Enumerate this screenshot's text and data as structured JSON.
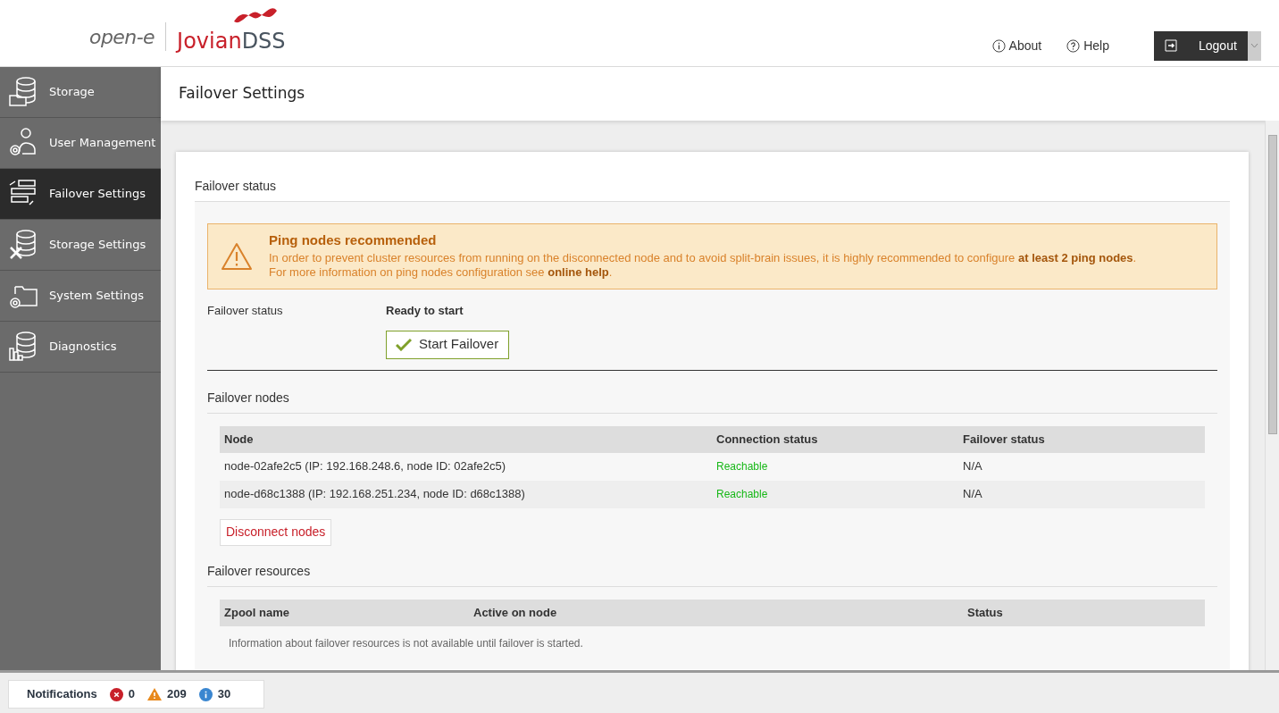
{
  "header": {
    "logo": {
      "brand": "open-e",
      "product_main": "Jovian",
      "product_suffix": "DSS"
    },
    "links": [
      {
        "kind": "info",
        "label": "About"
      },
      {
        "kind": "help",
        "label": "Help"
      }
    ],
    "logout": "Logout"
  },
  "sidebar": {
    "items": [
      {
        "kind": "storage",
        "label": "Storage",
        "selected": false
      },
      {
        "kind": "users",
        "label": "User Management",
        "selected": false
      },
      {
        "kind": "failover",
        "label": "Failover Settings",
        "selected": true
      },
      {
        "kind": "storage-settings",
        "label": "Storage Settings",
        "selected": false
      },
      {
        "kind": "system",
        "label": "System Settings",
        "selected": false
      },
      {
        "kind": "diagnostics",
        "label": "Diagnostics",
        "selected": false
      }
    ]
  },
  "page_title": "Failover Settings",
  "failover_status": {
    "heading": "Failover status",
    "alert": {
      "title": "Ping nodes recommended",
      "line1": "In order to prevent cluster resources from running on the disconnected node and to avoid split-brain issues, it is highly recommended to configure **at least 2 ping nodes**.",
      "line2": "For more information on ping nodes configuration see **online help**."
    },
    "label": "Failover status",
    "value": "Ready to start",
    "button": "Start Failover"
  },
  "failover_nodes": {
    "heading": "Failover nodes",
    "columns": [
      "Node",
      "Connection status",
      "Failover status"
    ],
    "rows": [
      {
        "node": "node-02afe2c5 (IP: 192.168.248.6, node ID: 02afe2c5)",
        "connection": "Reachable",
        "failover": "N/A"
      },
      {
        "node": "node-d68c1388 (IP: 192.168.251.234, node ID: d68c1388)",
        "connection": "Reachable",
        "failover": "N/A"
      }
    ],
    "button": "Disconnect nodes"
  },
  "failover_resources": {
    "heading": "Failover resources",
    "columns": [
      "Zpool name",
      "Active on node",
      "Status"
    ],
    "empty_message": "Information about failover resources is not available until failover is started."
  },
  "notifications": {
    "label": "Notifications",
    "counts": [
      {
        "kind": "error",
        "value": "0"
      },
      {
        "kind": "warning",
        "value": "209"
      },
      {
        "kind": "info",
        "value": "30"
      }
    ]
  }
}
